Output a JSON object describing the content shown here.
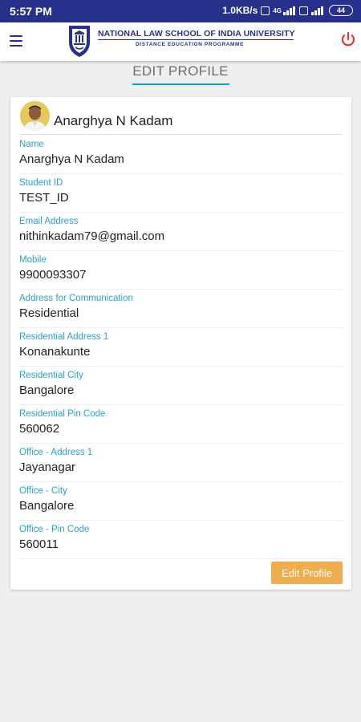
{
  "status_bar": {
    "time": "5:57 PM",
    "net_speed": "1.0KB/s",
    "network_type": "4G",
    "battery": "44"
  },
  "app_bar": {
    "logo_title": "NATIONAL LAW SCHOOL OF INDIA UNIVERSITY",
    "logo_subtitle": "DISTANCE EDUCATION PROGRAMME",
    "accent_color": "#27308a",
    "power_color": "#e53935"
  },
  "page": {
    "title": "EDIT PROFILE"
  },
  "profile": {
    "name": "Anarghya N Kadam",
    "fields": [
      {
        "label": "Name",
        "value": "Anarghya N Kadam"
      },
      {
        "label": "Student ID",
        "value": "TEST_ID"
      },
      {
        "label": "Email Address",
        "value": "nithinkadam79@gmail.com"
      },
      {
        "label": "Mobile",
        "value": "9900093307"
      },
      {
        "label": "Address for Communication",
        "value": "Residential"
      },
      {
        "label": "Residential Address 1",
        "value": "Konanakunte"
      },
      {
        "label": "Residential City",
        "value": "Bangalore"
      },
      {
        "label": "Residential Pin Code",
        "value": "560062"
      },
      {
        "label": "Office - Address 1",
        "value": "Jayanagar"
      },
      {
        "label": "Office - City",
        "value": "Bangalore"
      },
      {
        "label": "Office - Pin Code",
        "value": "560011"
      }
    ],
    "edit_button_label": "Edit Profile",
    "label_color": "#25a3cc",
    "button_color": "#f0ad4e"
  }
}
